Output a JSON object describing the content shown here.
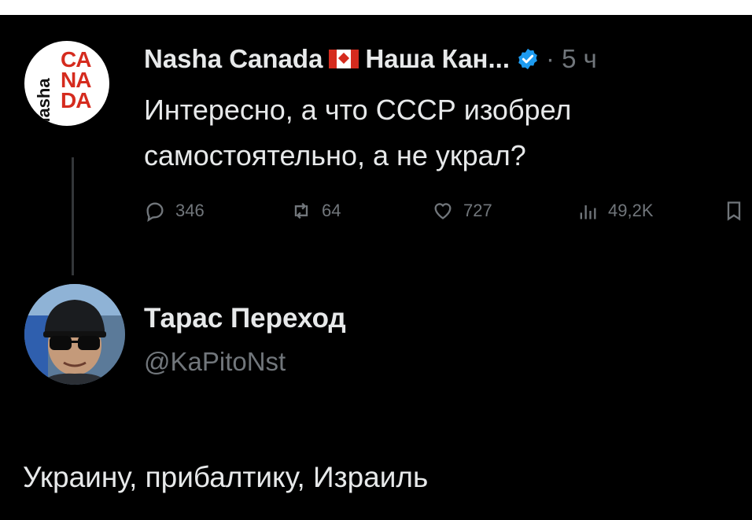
{
  "tweet": {
    "author_name": "Nasha Canada",
    "author_name_cyrillic": "Наша Кан...",
    "time": "· 5 ч",
    "text": "Интересно, а что СССР изобрел самостоятельно, а не украл?",
    "avatar": {
      "side_text": "nasha",
      "letters": [
        "CA",
        "NA",
        "DA"
      ]
    },
    "stats": {
      "replies": "346",
      "retweets": "64",
      "likes": "727",
      "views": "49,2K"
    },
    "colors": {
      "brand_red": "#d52b1e",
      "verified_blue": "#1d9bf0",
      "muted": "#71767b"
    }
  },
  "reply": {
    "author_name": "Тарас Переход",
    "handle": "@KaPitoNst",
    "text": "Украину, прибалтику, Израиль"
  },
  "icons": [
    "reply-icon",
    "retweet-icon",
    "like-icon",
    "views-icon",
    "bookmark-icon",
    "verified-icon",
    "canada-flag-icon"
  ]
}
